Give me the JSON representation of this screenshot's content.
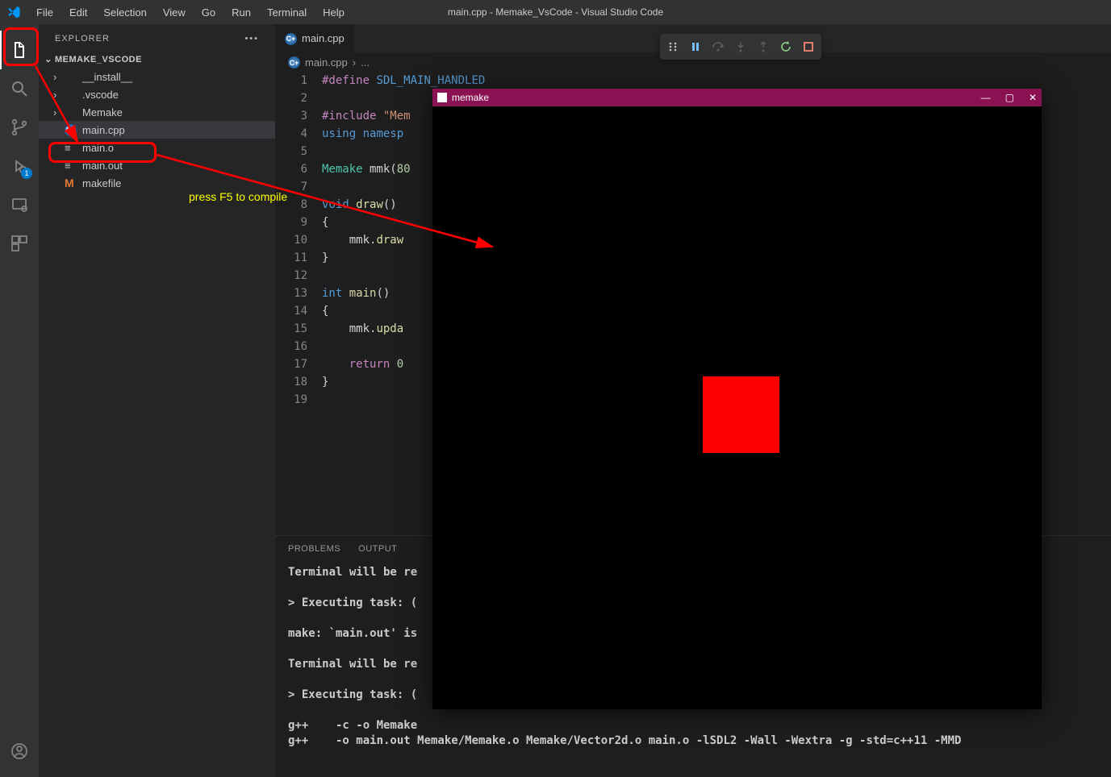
{
  "titlebar": {
    "title": "main.cpp - Memake_VsCode - Visual Studio Code",
    "menu": [
      "File",
      "Edit",
      "Selection",
      "View",
      "Go",
      "Run",
      "Terminal",
      "Help"
    ]
  },
  "explorer": {
    "label": "EXPLORER",
    "project": "MEMAKE_VSCODE",
    "items": [
      {
        "kind": "folder",
        "label": "__install__"
      },
      {
        "kind": "folder",
        "label": ".vscode"
      },
      {
        "kind": "folder",
        "label": "Memake"
      },
      {
        "kind": "file",
        "label": "main.cpp",
        "icon": "cpp",
        "selected": true
      },
      {
        "kind": "file",
        "label": "main.o",
        "icon": "generic"
      },
      {
        "kind": "file",
        "label": "main.out",
        "icon": "generic"
      },
      {
        "kind": "file",
        "label": "makefile",
        "icon": "m"
      }
    ]
  },
  "tab": {
    "label": "main.cpp"
  },
  "breadcrumb": {
    "file": "main.cpp",
    "more": "..."
  },
  "code": {
    "lines": [
      {
        "n": 1,
        "html": "<span class='tk-macro'>#define</span> <span class='tk-def'>SDL_MAIN_HANDLED</span>"
      },
      {
        "n": 2,
        "html": ""
      },
      {
        "n": 3,
        "html": "<span class='tk-macro'>#include</span> <span class='tk-str'>\"Mem</span>"
      },
      {
        "n": 4,
        "html": "<span class='tk-kw'>using</span> <span class='tk-kw'>namesp</span>"
      },
      {
        "n": 5,
        "html": ""
      },
      {
        "n": 6,
        "html": "<span class='tk-type'>Memake</span> mmk(<span class='tk-num'>80</span>"
      },
      {
        "n": 7,
        "html": ""
      },
      {
        "n": 8,
        "html": "<span class='tk-kw'>void</span> <span class='tk-fn'>draw</span>()"
      },
      {
        "n": 9,
        "html": "{"
      },
      {
        "n": 10,
        "html": "    mmk.<span class='tk-fn'>draw</span>"
      },
      {
        "n": 11,
        "html": "}"
      },
      {
        "n": 12,
        "html": ""
      },
      {
        "n": 13,
        "html": "<span class='tk-kw'>int</span> <span class='tk-fn'>main</span>()"
      },
      {
        "n": 14,
        "html": "{"
      },
      {
        "n": 15,
        "html": "    mmk.<span class='tk-fn'>upda</span>"
      },
      {
        "n": 16,
        "html": ""
      },
      {
        "n": 17,
        "html": "    <span class='tk-kw2'>return</span> <span class='tk-num'>0</span>"
      },
      {
        "n": 18,
        "html": "}"
      },
      {
        "n": 19,
        "html": ""
      }
    ]
  },
  "panel": {
    "tabs": [
      "PROBLEMS",
      "OUTPUT"
    ],
    "content": "Terminal will be re\n\n> Executing task: (\n\nmake: `main.out' is\n\nTerminal will be re\n\n> Executing task: (\n\ng++    -c -o Memake\ng++    -o main.out Memake/Memake.o Memake/Vector2d.o main.o -lSDL2 -Wall -Wextra -g -std=c++11 -MMD"
  },
  "app_window": {
    "title": "memake"
  },
  "annotation": {
    "hint": "press F5 to compile"
  },
  "activity": {
    "run_badge": "1"
  }
}
